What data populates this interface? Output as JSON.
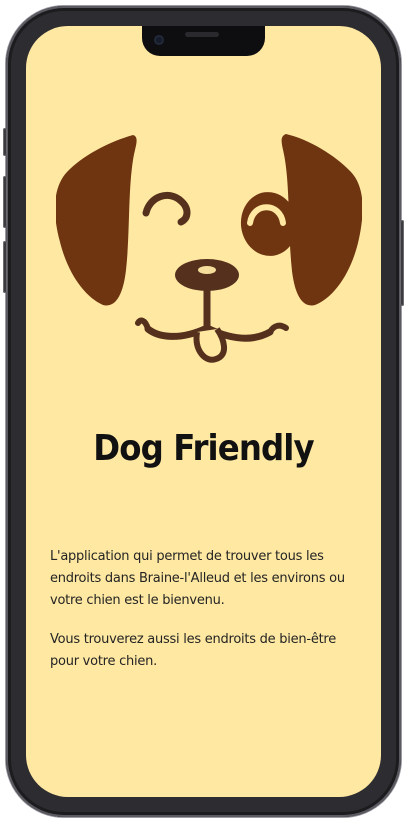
{
  "app": {
    "title": "Dog Friendly",
    "description": [
      "L'application qui permet de trouver tous les endroits dans Braine-l'Alleud et les environs ou votre chien est le bienvenu.",
      "Vous trouverez aussi les endroits de bien-être pour votre chien."
    ]
  },
  "theme": {
    "background": "#fee8a2",
    "dog_brown": "#6f3410",
    "dog_dark": "#55311d",
    "text": "#111111"
  },
  "illustration": {
    "icon": "winking-dog-icon"
  }
}
